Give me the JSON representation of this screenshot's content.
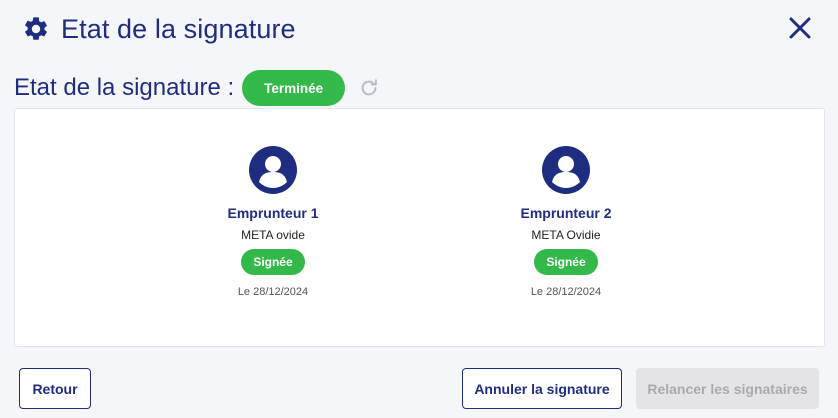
{
  "dialog": {
    "title": "Etat de la signature",
    "icon": "gear-icon",
    "close_icon": "close-icon"
  },
  "status": {
    "label": "Etat de la signature :",
    "value": "Terminée",
    "color": "#33b94a"
  },
  "signers": [
    {
      "title": "Emprunteur 1",
      "name": "META ovide",
      "status": "Signée",
      "date": "Le 28/12/2024"
    },
    {
      "title": "Emprunteur 2",
      "name": "META Ovidie",
      "status": "Signée",
      "date": "Le 28/12/2024"
    }
  ],
  "buttons": {
    "back": "Retour",
    "cancel": "Annuler la signature",
    "resend": "Relancer les signataires"
  },
  "colors": {
    "primary": "#1f2d80",
    "success": "#33b94a",
    "disabled_bg": "#e4e4e6"
  }
}
